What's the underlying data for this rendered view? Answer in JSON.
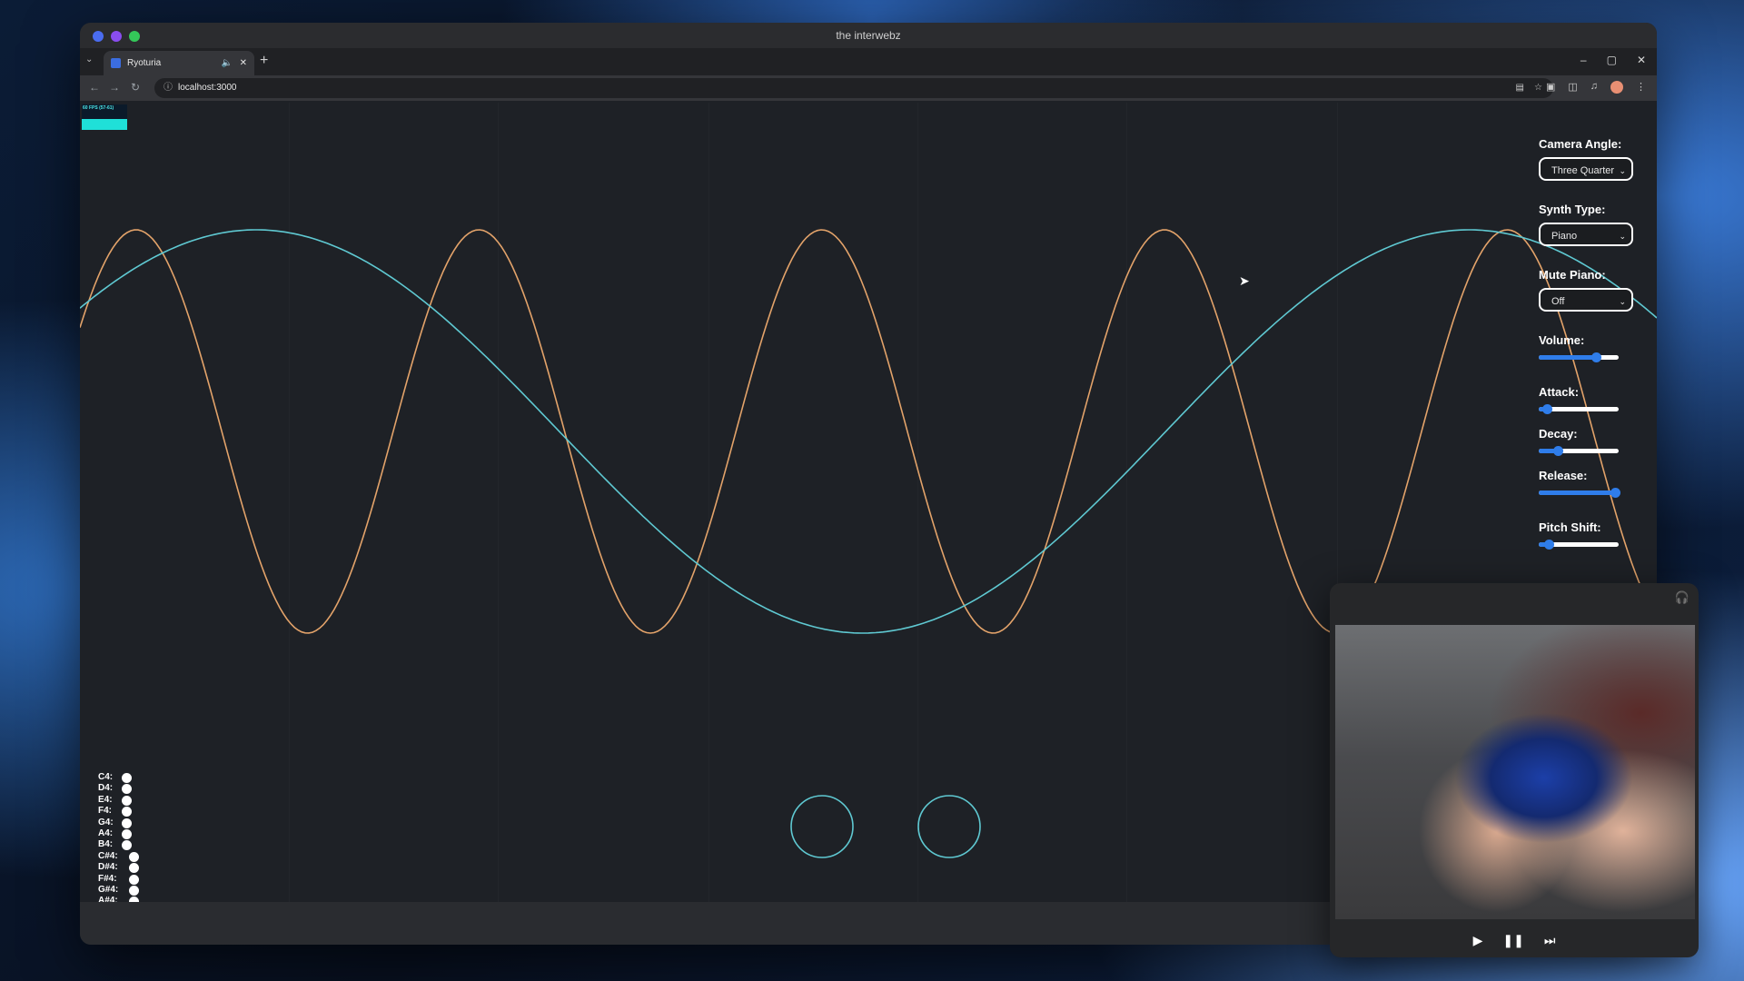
{
  "window": {
    "title": "the interwebz"
  },
  "tab": {
    "title": "Ryoturia",
    "sound_icon": "speaker-icon",
    "close": "✕",
    "new_tab": "+"
  },
  "address_bar": {
    "url": "localhost:3000"
  },
  "overlay": {
    "fps": "60 FPS (57-61)"
  },
  "controls": {
    "camera_angle": {
      "label": "Camera Angle:",
      "value": "Three Quarter"
    },
    "synth_type": {
      "label": "Synth Type:",
      "value": "Piano"
    },
    "mute_piano": {
      "label": "Mute Piano:",
      "value": "Off"
    },
    "volume": {
      "label": "Volume:",
      "level": 0.72
    },
    "attack": {
      "label": "Attack:",
      "level": 0.1
    },
    "decay": {
      "label": "Decay:",
      "level": 0.24
    },
    "release": {
      "label": "Release:",
      "level": 0.96
    },
    "pitch_shift": {
      "label": "Pitch Shift:",
      "level": 0.12
    }
  },
  "notes": [
    {
      "label": "C4:"
    },
    {
      "label": "D4:"
    },
    {
      "label": "E4:"
    },
    {
      "label": "F4:"
    },
    {
      "label": "G4:"
    },
    {
      "label": "A4:"
    },
    {
      "label": "B4:"
    },
    {
      "label": "C#4:"
    },
    {
      "label": "D#4:"
    },
    {
      "label": "F#4:"
    },
    {
      "label": "G#4:"
    },
    {
      "label": "A#4:"
    }
  ],
  "waves": {
    "orange_color": "#e3a36a",
    "cyan_color": "#5fc9d2"
  },
  "pip": {
    "icons": [
      "headphones-icon",
      "play-icon",
      "pause-icon",
      "next-track-icon"
    ]
  }
}
